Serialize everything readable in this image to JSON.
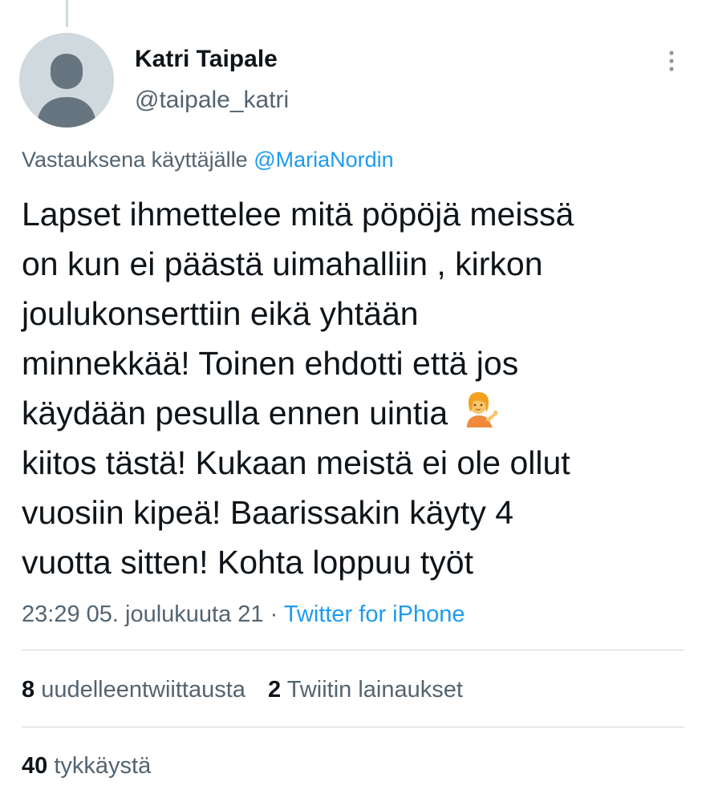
{
  "tweet": {
    "author": {
      "display_name": "Katri Taipale",
      "handle": "@taipale_katri"
    },
    "reply_context": {
      "prefix": "Vastauksena käyttäjälle",
      "mention": "@MariaNordin"
    },
    "text_lines": [
      "Lapset ihmettelee mitä pöpöjä meissä",
      "on kun ei päästä uimahalliin , kirkon",
      "joulukonserttiin eikä yhtään",
      "minnekkää! Toinen ehdotti että jos",
      "käydään pesulla ennen uintia",
      "kiitos tästä! Kukaan meistä ei ole ollut",
      "vuosiin kipeä! Baarissakin käyty 4",
      "vuotta sitten! Kohta loppuu työt"
    ],
    "emoji": "person-tipping-hand-emoji",
    "timestamp": "23:29 05. joulukuuta 21",
    "separator": "·",
    "source": "Twitter for iPhone"
  },
  "stats": {
    "retweets_count": "8",
    "retweets_label": "uudelleentwiittausta",
    "quotes_count": "2",
    "quotes_label": "Twiitin lainaukset",
    "likes_count": "40",
    "likes_label": "tykkäystä"
  },
  "icons": {
    "avatar": "default-avatar-icon",
    "more": "more-vertical-icon"
  },
  "colors": {
    "accent": "#1d9bf0",
    "text_primary": "#0f1419",
    "text_secondary": "#536471",
    "divider": "#cfd9de",
    "avatar_bg": "#cfd9de",
    "avatar_fg": "#66757f"
  }
}
